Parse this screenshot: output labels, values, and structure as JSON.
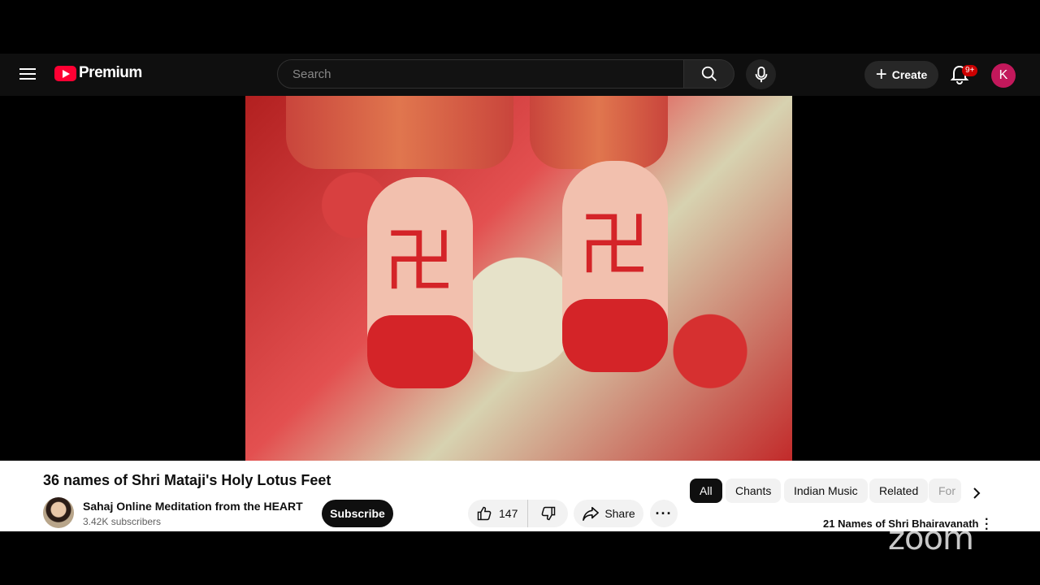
{
  "header": {
    "logo_text": "Premium",
    "search_placeholder": "Search",
    "create_label": "Create",
    "notification_badge": "9+",
    "account_initial": "K"
  },
  "video": {
    "title": "36 names of Shri Mataji's Holy Lotus Feet"
  },
  "channel": {
    "name": "Sahaj Online Meditation from the HEART",
    "subscribers": "3.42K subscribers",
    "subscribe_label": "Subscribe"
  },
  "actions": {
    "like_count": "147",
    "share_label": "Share"
  },
  "chips": [
    {
      "label": "All",
      "active": true
    },
    {
      "label": "Chants",
      "active": false
    },
    {
      "label": "Indian Music",
      "active": false
    },
    {
      "label": "Related",
      "active": false
    },
    {
      "label": "For",
      "active": false
    }
  ],
  "related": {
    "first_title": "21 Names of Shri Bhairavanath"
  },
  "overlay": {
    "watermark": "zoom"
  },
  "colors": {
    "brand_red": "#ff0033",
    "avatar_bg": "#c2185b",
    "badge_red": "#cc0000"
  }
}
